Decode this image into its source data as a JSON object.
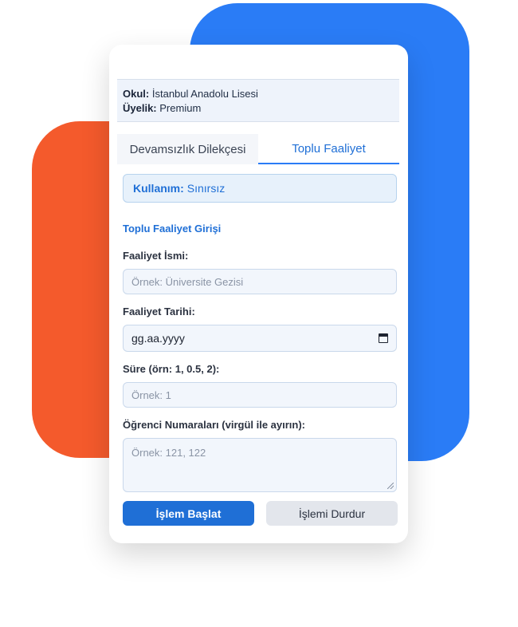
{
  "info": {
    "school_label": "Okul:",
    "school_value": "İstanbul Anadolu Lisesi",
    "membership_label": "Üyelik:",
    "membership_value": "Premium"
  },
  "tabs": [
    {
      "label": "Devamsızlık Dilekçesi",
      "active": false
    },
    {
      "label": "Toplu Faaliyet",
      "active": true
    }
  ],
  "usage": {
    "label": "Kullanım:",
    "value": "Sınırsız"
  },
  "form": {
    "section_title": "Toplu Faaliyet Girişi",
    "activity_name": {
      "label": "Faaliyet İsmi:",
      "placeholder": "Örnek: Üniversite Gezisi",
      "value": ""
    },
    "activity_date": {
      "label": "Faaliyet Tarihi:",
      "value": "gg.aa.yyyy",
      "icon": "calendar-icon"
    },
    "duration": {
      "label": "Süre (örn: 1, 0.5, 2):",
      "placeholder": "Örnek: 1",
      "value": ""
    },
    "student_numbers": {
      "label": "Öğrenci Numaraları (virgül ile ayırın):",
      "placeholder": "Örnek: 121, 122",
      "value": ""
    }
  },
  "buttons": {
    "start": "İşlem Başlat",
    "stop": "İşlemi Durdur"
  },
  "colors": {
    "accent": "#1f6fd6",
    "blue_shape": "#2a7cf6",
    "orange_shape": "#f45a2c"
  }
}
